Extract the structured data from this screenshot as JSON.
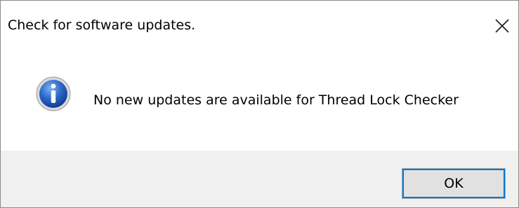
{
  "window": {
    "title": "Check for software updates."
  },
  "dialog": {
    "icon": "info-icon",
    "message": "No new updates are available for Thread Lock Checker"
  },
  "buttons": {
    "ok_label": "OK"
  },
  "colors": {
    "footer_background": "#f0f0f0",
    "button_focus": "#0078d7",
    "icon_blue": "#1b56b6"
  }
}
